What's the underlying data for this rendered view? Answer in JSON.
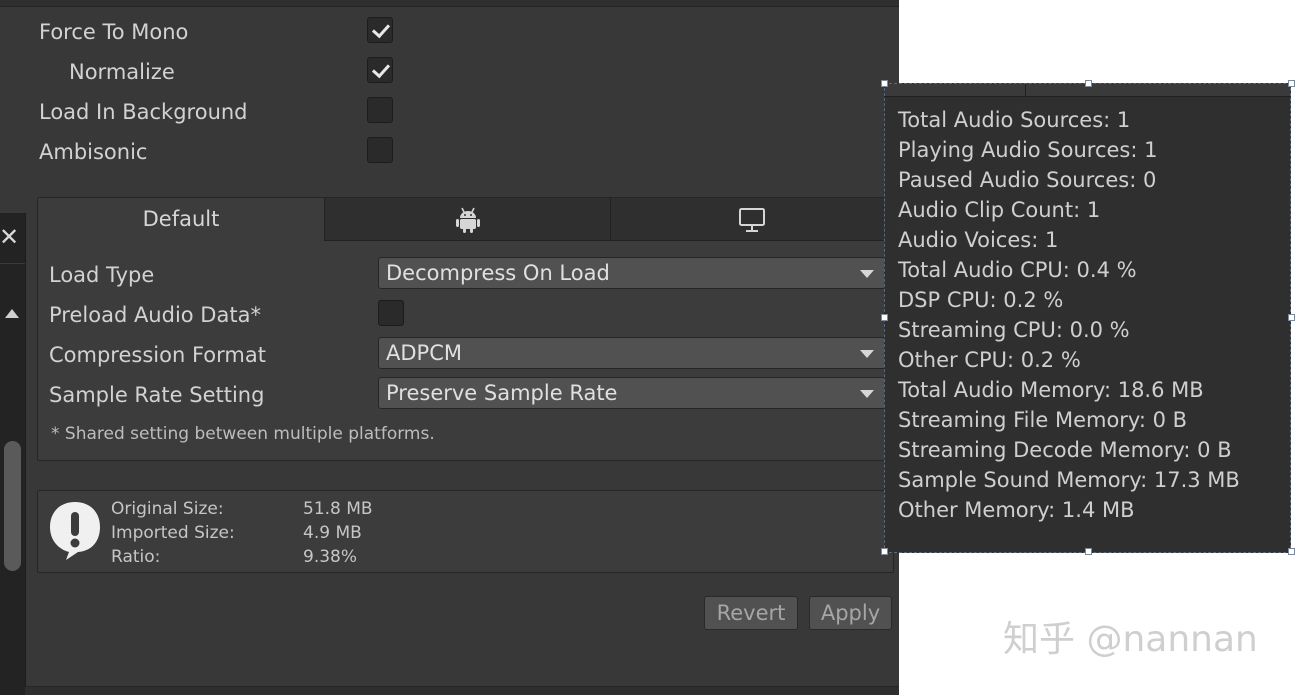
{
  "audio_options": {
    "force_to_mono": {
      "label": "Force To Mono",
      "checked": true
    },
    "normalize": {
      "label": "Normalize",
      "checked": true
    },
    "load_in_background": {
      "label": "Load In Background",
      "checked": false
    },
    "ambisonic": {
      "label": "Ambisonic",
      "checked": false
    }
  },
  "platform_tabs": [
    {
      "label": "Default",
      "active": true
    },
    {
      "icon": "android-icon",
      "active": false
    },
    {
      "icon": "monitor-icon",
      "active": false
    }
  ],
  "platform_settings": {
    "load_type": {
      "label": "Load Type",
      "value": "Decompress On Load"
    },
    "preload_audio_data": {
      "label": "Preload Audio Data*",
      "checked": false
    },
    "compression_format": {
      "label": "Compression Format",
      "value": "ADPCM"
    },
    "sample_rate_setting": {
      "label": "Sample Rate Setting",
      "value": "Preserve Sample Rate"
    },
    "footnote": "* Shared setting between multiple platforms."
  },
  "import_info": {
    "original_size_label": "Original Size:",
    "original_size_value": "51.8 MB",
    "imported_size_label": "Imported Size:",
    "imported_size_value": "4.9 MB",
    "ratio_label": "Ratio:",
    "ratio_value": "9.38%"
  },
  "actions": {
    "revert_label": "Revert",
    "apply_label": "Apply"
  },
  "audio_stats": [
    "Total Audio Sources: 1",
    "Playing Audio Sources: 1",
    "Paused Audio Sources: 0",
    "Audio Clip Count: 1",
    "Audio Voices: 1",
    "Total Audio CPU: 0.4 %",
    "DSP CPU: 0.2 %",
    "Streaming CPU: 0.0 %",
    "Other CPU: 0.2 %",
    "Total Audio Memory: 18.6 MB",
    "Streaming File Memory: 0 B",
    "Streaming Decode Memory: 0 B",
    "Sample Sound Memory: 17.3 MB",
    "Other Memory: 1.4 MB"
  ],
  "watermark": "知乎 @nannan",
  "colors": {
    "panel_bg": "#383838",
    "field_bg": "#515151",
    "text": "#d2d2d2"
  }
}
